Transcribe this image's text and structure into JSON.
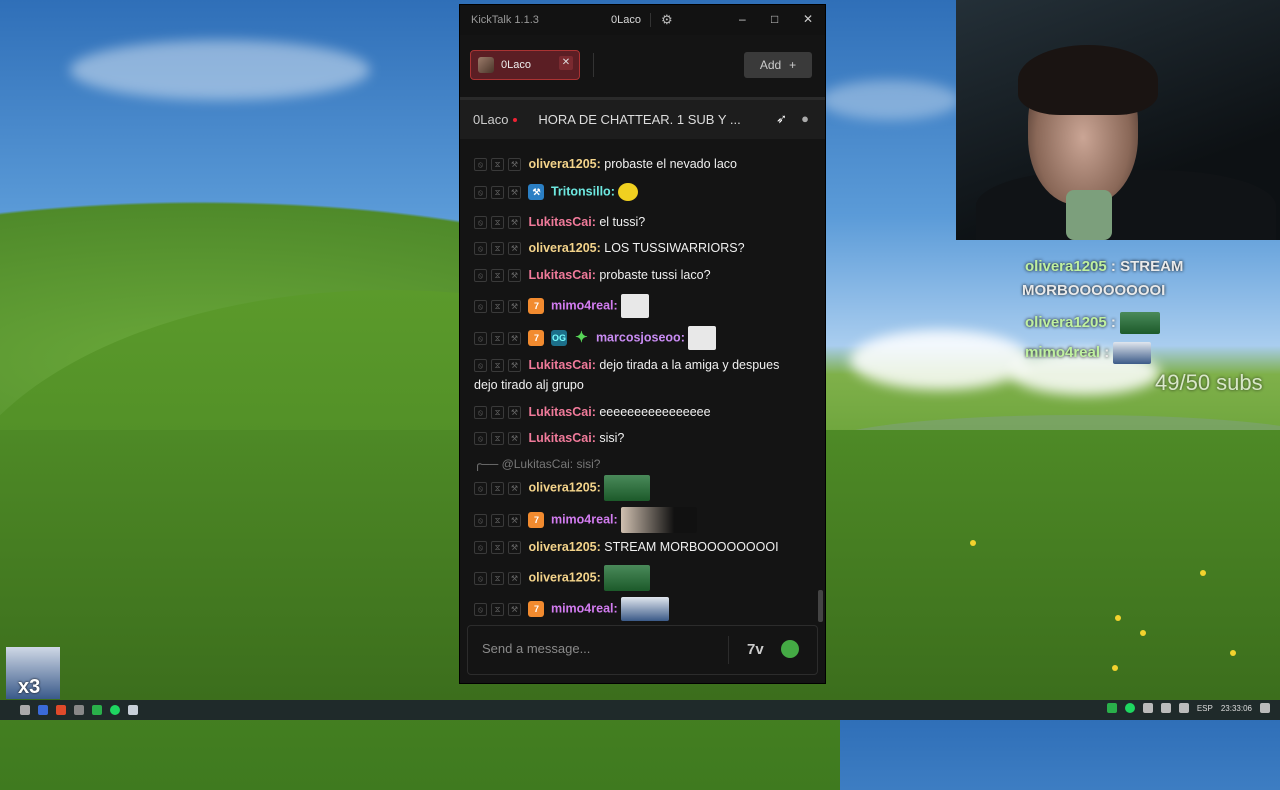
{
  "window": {
    "app_title": "KickTalk 1.1.3",
    "user": "0Laco",
    "controls": {
      "minimize": "–",
      "maximize": "□",
      "close": "✕"
    }
  },
  "tabs": [
    {
      "label": "0Laco",
      "close": "✕"
    }
  ],
  "add_button": {
    "label": "Add",
    "icon": "+"
  },
  "stream": {
    "channel": "0Laco",
    "title": "HORA DE CHATTEAR. 1 SUB Y ..."
  },
  "messages": [
    {
      "user": "olivera1205:",
      "text": "probaste el nevado laco"
    },
    {
      "user": "Tritonsillo:",
      "text": "",
      "emote": "helmet-emote"
    },
    {
      "user": "LukitasCai:",
      "text": "el tussi?"
    },
    {
      "user": "olivera1205:",
      "text": "LOS TUSSIWARRIORS?"
    },
    {
      "user": "LukitasCai:",
      "text": "probaste tussi laco?"
    },
    {
      "user": "mimo4real:",
      "text": "",
      "emote": "sketch-emote"
    },
    {
      "user": "marcosjoseoo:",
      "text": "",
      "emote": "sketch-emote"
    },
    {
      "user": "LukitasCai:",
      "text": "dejo tirada a la amiga y despues",
      "text2": "dejo tirado alj grupo"
    },
    {
      "user": "LukitasCai:",
      "text": "eeeeeeeeeeeeeeee"
    },
    {
      "user": "LukitasCai:",
      "text": "sisi?"
    },
    {
      "reply": "@LukitasCai: sisi?"
    },
    {
      "user": "olivera1205:",
      "text": "",
      "emote": "team-photo-emote"
    },
    {
      "user": "mimo4real:",
      "text": "",
      "emote": "face-emote"
    },
    {
      "user": "olivera1205:",
      "text": "STREAM MORBOOOOOOOOI"
    },
    {
      "user": "olivera1205:",
      "text": "",
      "emote": "team-photo-emote"
    },
    {
      "user": "mimo4real:",
      "text": "",
      "emote": "photo-emote"
    }
  ],
  "input": {
    "placeholder": "Send a message..."
  },
  "overlay": {
    "line1_name": "olivera1205",
    "line1_text": ": STREAM",
    "line1_cont": "MORBOOOOOOOOI",
    "line2_name": "olivera1205",
    "line2_text": ":",
    "line3_name": "mimo4real",
    "line3_text": ":",
    "subs": "49/50 subs"
  },
  "taskbar": {
    "lang": "ESP",
    "time": "23:33:06"
  },
  "thumbnail": {
    "badge": "x3"
  }
}
